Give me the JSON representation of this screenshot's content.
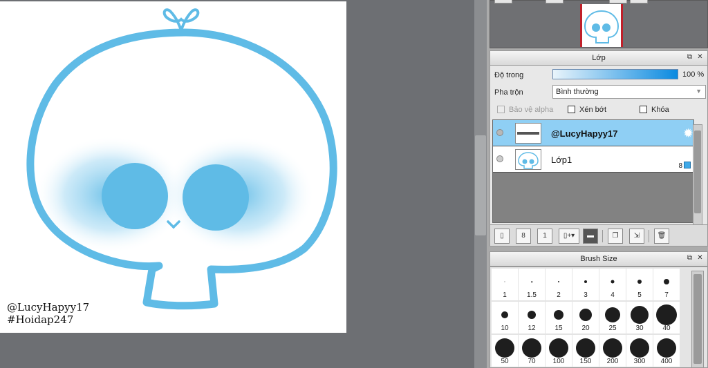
{
  "canvas": {
    "signature_line1": "@LucyHapyy17",
    "signature_line2": "#Hoidap247"
  },
  "colors": {
    "skull_stroke": "#5fbbe6",
    "cheek_blue": "#5fbbe6",
    "selected_layer": "#8fcff4"
  },
  "layer_panel": {
    "title": "Lớp",
    "opacity_label": "Độ trong",
    "opacity_value": "100 %",
    "opacity_fraction": 1.0,
    "blend_label": "Pha trộn",
    "blend_value": "Bình thường",
    "protect_alpha": "Bảo vệ alpha",
    "clipping": "Xén bớt",
    "lock": "Khóa",
    "layers": [
      {
        "name": "@LucyHapyy17",
        "selected": true,
        "icon": "gear-icon"
      },
      {
        "name": "Lớp1",
        "selected": false,
        "badge": "8"
      }
    ],
    "toolbar_icons": [
      "new-layer-icon",
      "new-8bit-layer-icon",
      "new-1bit-layer-icon",
      "add-layer-menu-icon",
      "new-folder-icon",
      "duplicate-layer-icon",
      "merge-layer-icon",
      "delete-layer-icon"
    ],
    "toolbar_labels": [
      "",
      "8",
      "1",
      "",
      "",
      "",
      "",
      ""
    ]
  },
  "brush_panel": {
    "title": "Brush Size",
    "sizes": [
      "1",
      "1.5",
      "2",
      "3",
      "4",
      "5",
      "7",
      "10",
      "12",
      "15",
      "20",
      "25",
      "30",
      "40",
      "50",
      "70",
      "100",
      "150",
      "200",
      "300",
      "400"
    ]
  }
}
